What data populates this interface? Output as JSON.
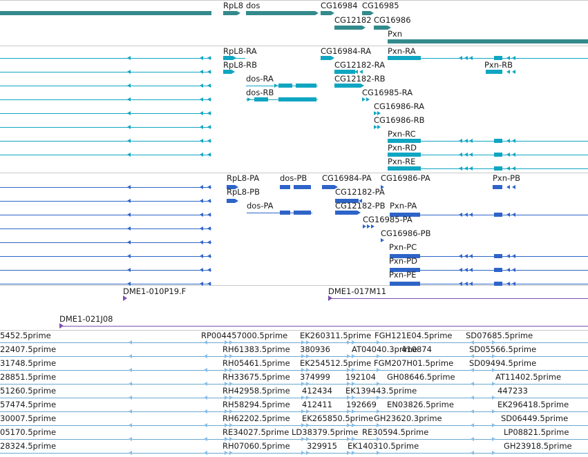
{
  "colors": {
    "gene": "#338a8c",
    "mrna": "#0fa6c2",
    "cds": "#2e64c8",
    "clone": "#7d4fb0",
    "est": "#86bde6",
    "est_line": "#6aa9cf",
    "track_line": "#1c7fb0",
    "divider": "#c8c8c8"
  },
  "tracks": {
    "genes": {
      "labels": [
        "RpL8",
        "dos",
        "CG16984",
        "CG16985",
        "CG12182",
        "CG16986",
        "Pxn"
      ]
    },
    "transcripts": {
      "labels": [
        "RpL8-RA",
        "RpL8-RB",
        "dos-RA",
        "dos-RB",
        "CG16984-RA",
        "CG12182-RA",
        "CG12182-RB",
        "CG16985-RA",
        "CG16986-RA",
        "CG16986-RB",
        "Pxn-RA",
        "Pxn-RB",
        "Pxn-RC",
        "Pxn-RD",
        "Pxn-RE"
      ]
    },
    "proteins": {
      "labels": [
        "RpL8-PA",
        "RpL8-PB",
        "dos-PA",
        "dos-PB",
        "CG16984-PA",
        "CG12182-PA",
        "CG12182-PB",
        "CG16985-PA",
        "CG16986-PA",
        "CG16986-PB",
        "Pxn-PA",
        "Pxn-PB",
        "Pxn-PC",
        "Pxn-PD",
        "Pxn-PE"
      ]
    },
    "clones": {
      "labels": [
        "DME1-010P19.F",
        "DME1-017M11",
        "DME1-021J08"
      ]
    },
    "ests": {
      "left": [
        "5452.5prime",
        "22407.5prime",
        "31748.5prime",
        "28851.5prime",
        "51260.5prime",
        "57474.5prime",
        "30007.5prime",
        "05170.5prime",
        "28324.5prime"
      ],
      "mid": [
        "RP004457000.5prime",
        "RH61383.5prime",
        "RH05461.5prime",
        "RH33675.5prime",
        "RH42958.5prime",
        "RH58294.5prime",
        "RH62202.5prime",
        "RE34027.5prime",
        "RH07060.5prime"
      ],
      "mid2": [
        "EK260311.5prime",
        "380936",
        "EK254512.5prime",
        "374999",
        "412434",
        "412411",
        "EK265850.5prime",
        "LD38379.5prime",
        "329915"
      ],
      "mid3": [
        "AT04040.3prime",
        "192104",
        "EK139443.5prime",
        "192669",
        "EK140310.5prime",
        "RE30594.5prime"
      ],
      "right_a": [
        "FGH121E04.5prime",
        "410874",
        "FGM207H01.5prime",
        "GH08646.5prime",
        "EN03826.5prime",
        "GH23620.3prime"
      ],
      "right": [
        "SD07685.5prime",
        "SD05566.5prime",
        "SD09494.5prime",
        "AT11402.5prime",
        "447233",
        "EK296418.5prime",
        "SD06449.5prime",
        "LP08821.5prime",
        "GH23918.5prime"
      ]
    }
  }
}
